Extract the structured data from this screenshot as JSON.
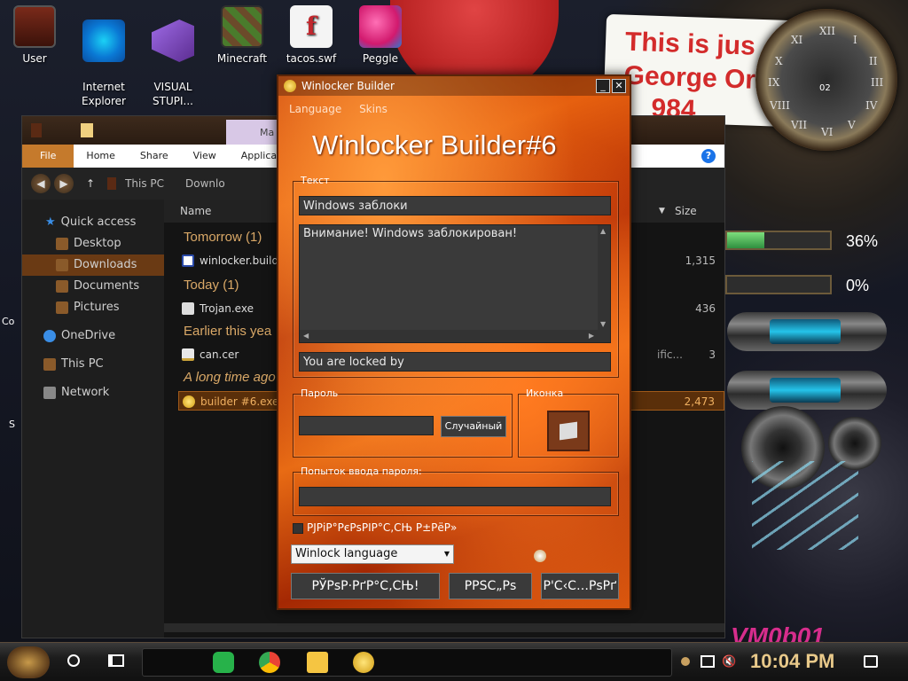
{
  "desktop": {
    "icons": [
      {
        "label": "User"
      },
      {
        "label": "Internet\nExplorer"
      },
      {
        "label": "VISUAL\nSTUPI..."
      },
      {
        "label": "Minecraft"
      },
      {
        "label": "tacos.swf"
      },
      {
        "label": "Peggle"
      }
    ],
    "swf_glyph": "SWF f",
    "note_lines": [
      "This is jus",
      "George Or",
      "984"
    ],
    "clock_numerals": [
      "XII",
      "I",
      "II",
      "III",
      "IV",
      "V",
      "VI",
      "VII",
      "VIII",
      "IX",
      "X",
      "XI"
    ],
    "clock_digit": "02",
    "meters": [
      {
        "label": "36%",
        "value": 0.36
      },
      {
        "label": "0%",
        "value": 0.0
      }
    ],
    "watermark": "VM0b01",
    "edge_fragments": [
      "Co",
      "S"
    ]
  },
  "explorer": {
    "tab_tint_label": "Ma",
    "ribbon": [
      "File",
      "Home",
      "Share",
      "View",
      "Applicat"
    ],
    "help": "?",
    "address": {
      "back": "◀",
      "forward": "▶",
      "up": "↑",
      "crumbs": [
        "This PC",
        "Downlo"
      ]
    },
    "sidebar": [
      {
        "label": "Quick access",
        "icon": "star-icon",
        "color": "#3a8ee6"
      },
      {
        "label": "Desktop",
        "icon": "folder-icon",
        "color": "#8a5a2a"
      },
      {
        "label": "Downloads",
        "icon": "folder-icon",
        "color": "#8a5a2a",
        "selected": true
      },
      {
        "label": "Documents",
        "icon": "folder-icon",
        "color": "#8a5a2a"
      },
      {
        "label": "Pictures",
        "icon": "folder-icon",
        "color": "#8a5a2a"
      },
      {
        "label": "OneDrive",
        "icon": "cloud-icon",
        "color": "#3a8ee6"
      },
      {
        "label": "This PC",
        "icon": "computer-icon",
        "color": "#8a5a2a"
      },
      {
        "label": "Network",
        "icon": "network-icon",
        "color": "#888"
      }
    ],
    "columns": {
      "name": "Name",
      "size": "Size"
    },
    "groups": [
      {
        "label": "Tomorrow (1)",
        "files": [
          {
            "name": "winlocker.builde",
            "size": "1,315",
            "extra": ""
          }
        ]
      },
      {
        "label": "Today (1)",
        "files": [
          {
            "name": "Trojan.exe",
            "size": "436",
            "extra": ""
          }
        ]
      },
      {
        "label": "Earlier this yea",
        "files": [
          {
            "name": "can.cer",
            "size": "3",
            "extra": "ific..."
          }
        ]
      },
      {
        "label": "A long time ago",
        "files": [
          {
            "name": "builder #6.exe",
            "size": "2,473",
            "extra": "",
            "selected": true
          }
        ]
      }
    ]
  },
  "winlocker": {
    "title": "Winlocker Builder",
    "menu": [
      "Language",
      "Skins"
    ],
    "heading": "Winlocker Builder#6",
    "text_group": {
      "legend": "Текст",
      "title_value": "Windows заблоки",
      "body_value": "Внимание! Windows заблокирован!",
      "footer_value": "You are locked by"
    },
    "password_group": {
      "legend": "Пароль",
      "value": "",
      "random_button": "Случайный"
    },
    "icon_group": {
      "legend": "Иконка"
    },
    "attempts_group": {
      "legend": "Попыток ввода пароля:",
      "value": ""
    },
    "checkbox_label": "РЈРіР°РєРѕРІР°С‚СЊ Р±РёР»",
    "language_select": "Winlock language",
    "buttons": [
      "РЎРѕР·РґР°С‚СЊ!",
      "РРЅС„Рѕ",
      "Р'С‹С…РѕРґ"
    ],
    "min_label": "_",
    "close_label": "✕"
  },
  "taskbar": {
    "time": "10:04 PM"
  }
}
